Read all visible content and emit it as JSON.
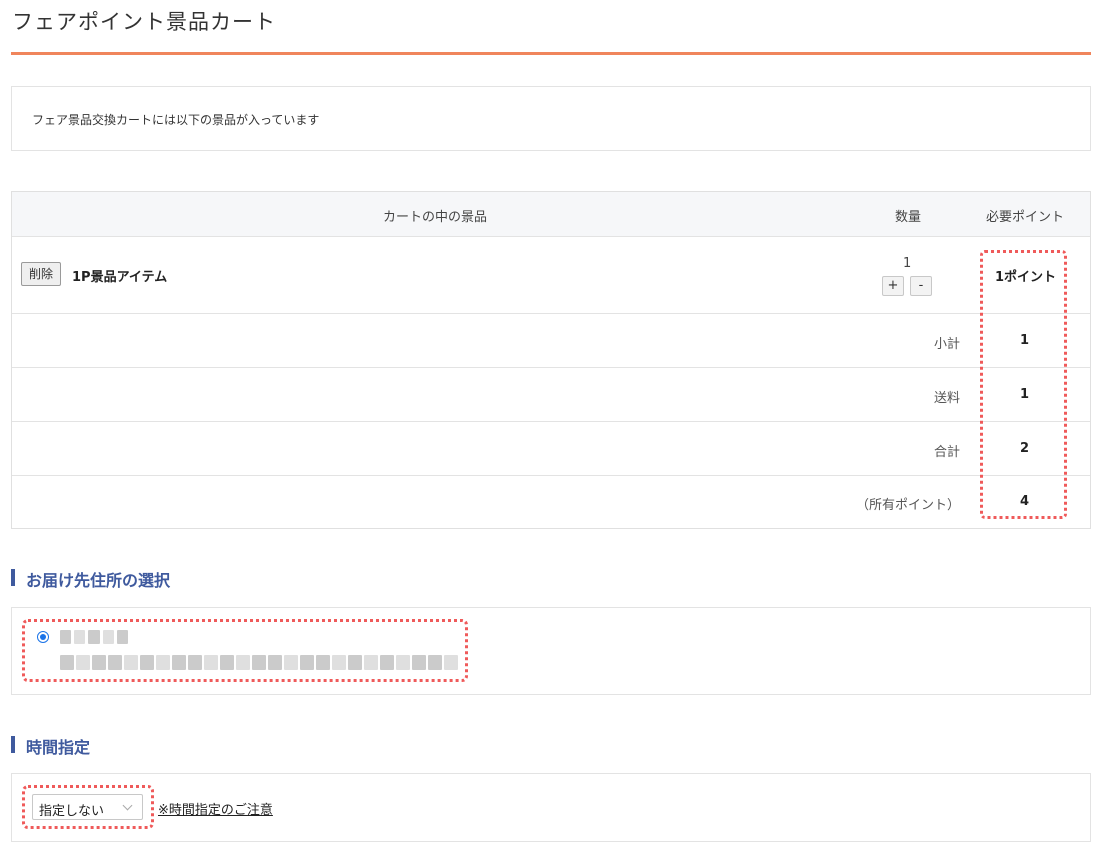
{
  "page": {
    "title": "フェアポイント景品カート"
  },
  "notice": {
    "text": "フェア景品交換カートには以下の景品が入っています"
  },
  "cart": {
    "headers": {
      "item": "カートの中の景品",
      "quantity": "数量",
      "points": "必要ポイント"
    },
    "items": [
      {
        "delete_label": "削除",
        "name": "1P景品アイテム",
        "quantity": "1",
        "plus_label": "+",
        "minus_label": "-",
        "points": "1ポイント"
      }
    ],
    "summary": [
      {
        "label": "小計",
        "value": "1"
      },
      {
        "label": "送料",
        "value": "1"
      },
      {
        "label": "合計",
        "value": "2"
      },
      {
        "label": "（所有ポイント）",
        "value": "4"
      }
    ]
  },
  "address_section": {
    "heading": "お届け先住所の選択",
    "selected": true
  },
  "time_section": {
    "heading": "時間指定",
    "selected_option": "指定しない",
    "note_link": "※時間指定のご注意"
  },
  "colors": {
    "accent_rule": "#f0855c",
    "heading": "#3f5a9e",
    "highlight": "#ef5a5a",
    "radio": "#1a73e8"
  }
}
